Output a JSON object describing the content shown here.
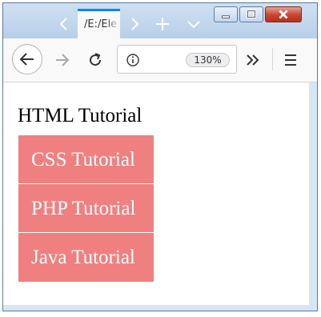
{
  "browser": {
    "tab": {
      "title": "/E:/Ele"
    },
    "url_bar": {
      "info_icon": "info-icon",
      "zoom": "130%"
    },
    "colors": {
      "tab_accent": "#0a84ff",
      "close_button": "#c7442e"
    }
  },
  "page": {
    "heading": "HTML Tutorial",
    "menu_items": [
      {
        "label": "CSS Tutorial"
      },
      {
        "label": "PHP Tutorial"
      },
      {
        "label": "Java Tutorial"
      }
    ],
    "menu_color": "#f08080"
  }
}
